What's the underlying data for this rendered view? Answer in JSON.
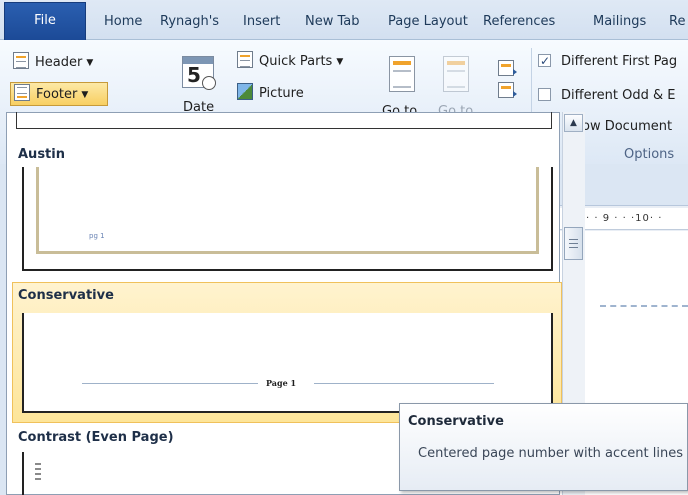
{
  "tabs": {
    "file": "File",
    "home": "Home",
    "rynagh": "Rynagh's",
    "insert": "Insert",
    "new_tab": "New Tab",
    "page_layout": "Page Layout",
    "references": "References",
    "mailings": "Mailings",
    "review_partial": "Re"
  },
  "ribbon": {
    "header_label": "Header",
    "footer_label": "Footer",
    "date_number": "5",
    "date_label": "Date",
    "quick_parts_label": "Quick Parts",
    "picture_label": "Picture",
    "goto_header_label": "Go to",
    "goto_footer_label": "Go to",
    "different_first_page": "Different First Pag",
    "different_first_page_checked": true,
    "different_odd_even": "Different Odd & E",
    "different_odd_even_checked": false,
    "show_document_text": "ow Document",
    "options_group": "Options"
  },
  "gallery": {
    "austin_title": "Austin",
    "austin_preview_text": "pg 1",
    "conservative_title": "Conservative",
    "conservative_preview_text": "Page 1",
    "contrast_title": "Contrast (Even Page)"
  },
  "ruler": {
    "text": "· · 9 · · ·10· ·"
  },
  "tooltip": {
    "title": "Conservative",
    "body": "Centered page number with accent lines"
  },
  "colors": {
    "file_tab": "#1c4a97",
    "hover_gold": "#fde59a",
    "accent_orange": "#f0a32c"
  }
}
